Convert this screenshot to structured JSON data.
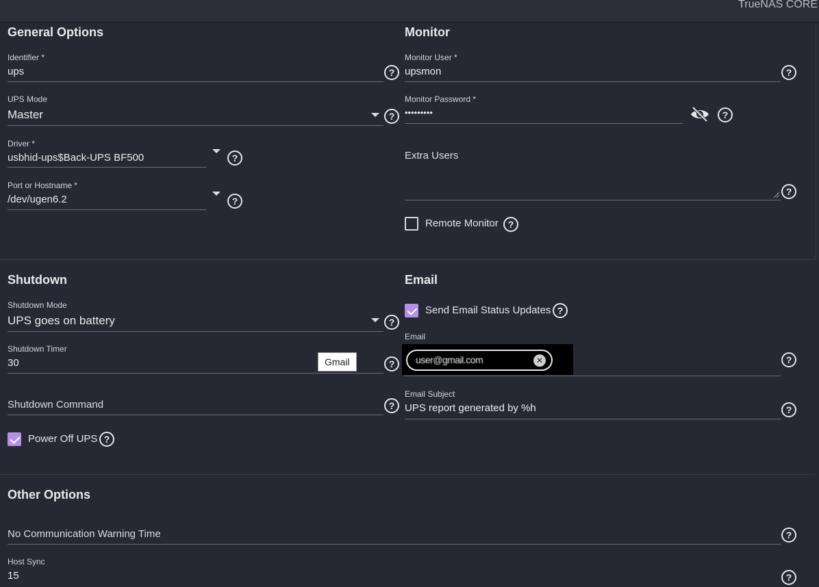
{
  "header": {
    "brand": "TrueNAS CORE"
  },
  "general": {
    "title": "General Options",
    "identifier": {
      "label": "Identifier *",
      "value": "ups"
    },
    "ups_mode": {
      "label": "UPS Mode",
      "value": "Master"
    },
    "driver": {
      "label": "Driver *",
      "value": "usbhid-ups$Back-UPS BF500"
    },
    "port": {
      "label": "Port or Hostname *",
      "value": "/dev/ugen6.2"
    }
  },
  "monitor": {
    "title": "Monitor",
    "user": {
      "label": "Monitor User *",
      "value": "upsmon"
    },
    "password": {
      "label": "Monitor Password *",
      "value": "•••••••••"
    },
    "extra_users": {
      "placeholder": "Extra Users"
    },
    "remote_monitor": {
      "label": "Remote Monitor",
      "checked": false
    }
  },
  "shutdown": {
    "title": "Shutdown",
    "mode": {
      "label": "Shutdown Mode",
      "value": "UPS goes on battery"
    },
    "timer": {
      "label": "Shutdown Timer",
      "value": "30"
    },
    "command": {
      "placeholder": "Shutdown Command"
    },
    "power_off": {
      "label": "Power Off UPS",
      "checked": true
    }
  },
  "email": {
    "title": "Email",
    "send_updates": {
      "label": "Send Email Status Updates",
      "checked": true
    },
    "email_field": {
      "label": "Email",
      "chip": "user@gmail.com"
    },
    "subject": {
      "label": "Email Subject",
      "value": "UPS report generated by %h"
    },
    "tooltip": "Gmail"
  },
  "other": {
    "title": "Other Options",
    "no_comm": {
      "placeholder": "No Communication Warning Time"
    },
    "host_sync": {
      "label": "Host Sync",
      "value": "15"
    }
  },
  "icons": {
    "help": "?",
    "chip_close": "✕"
  },
  "colors": {
    "background": "#262833",
    "accent": "#b591e6"
  }
}
